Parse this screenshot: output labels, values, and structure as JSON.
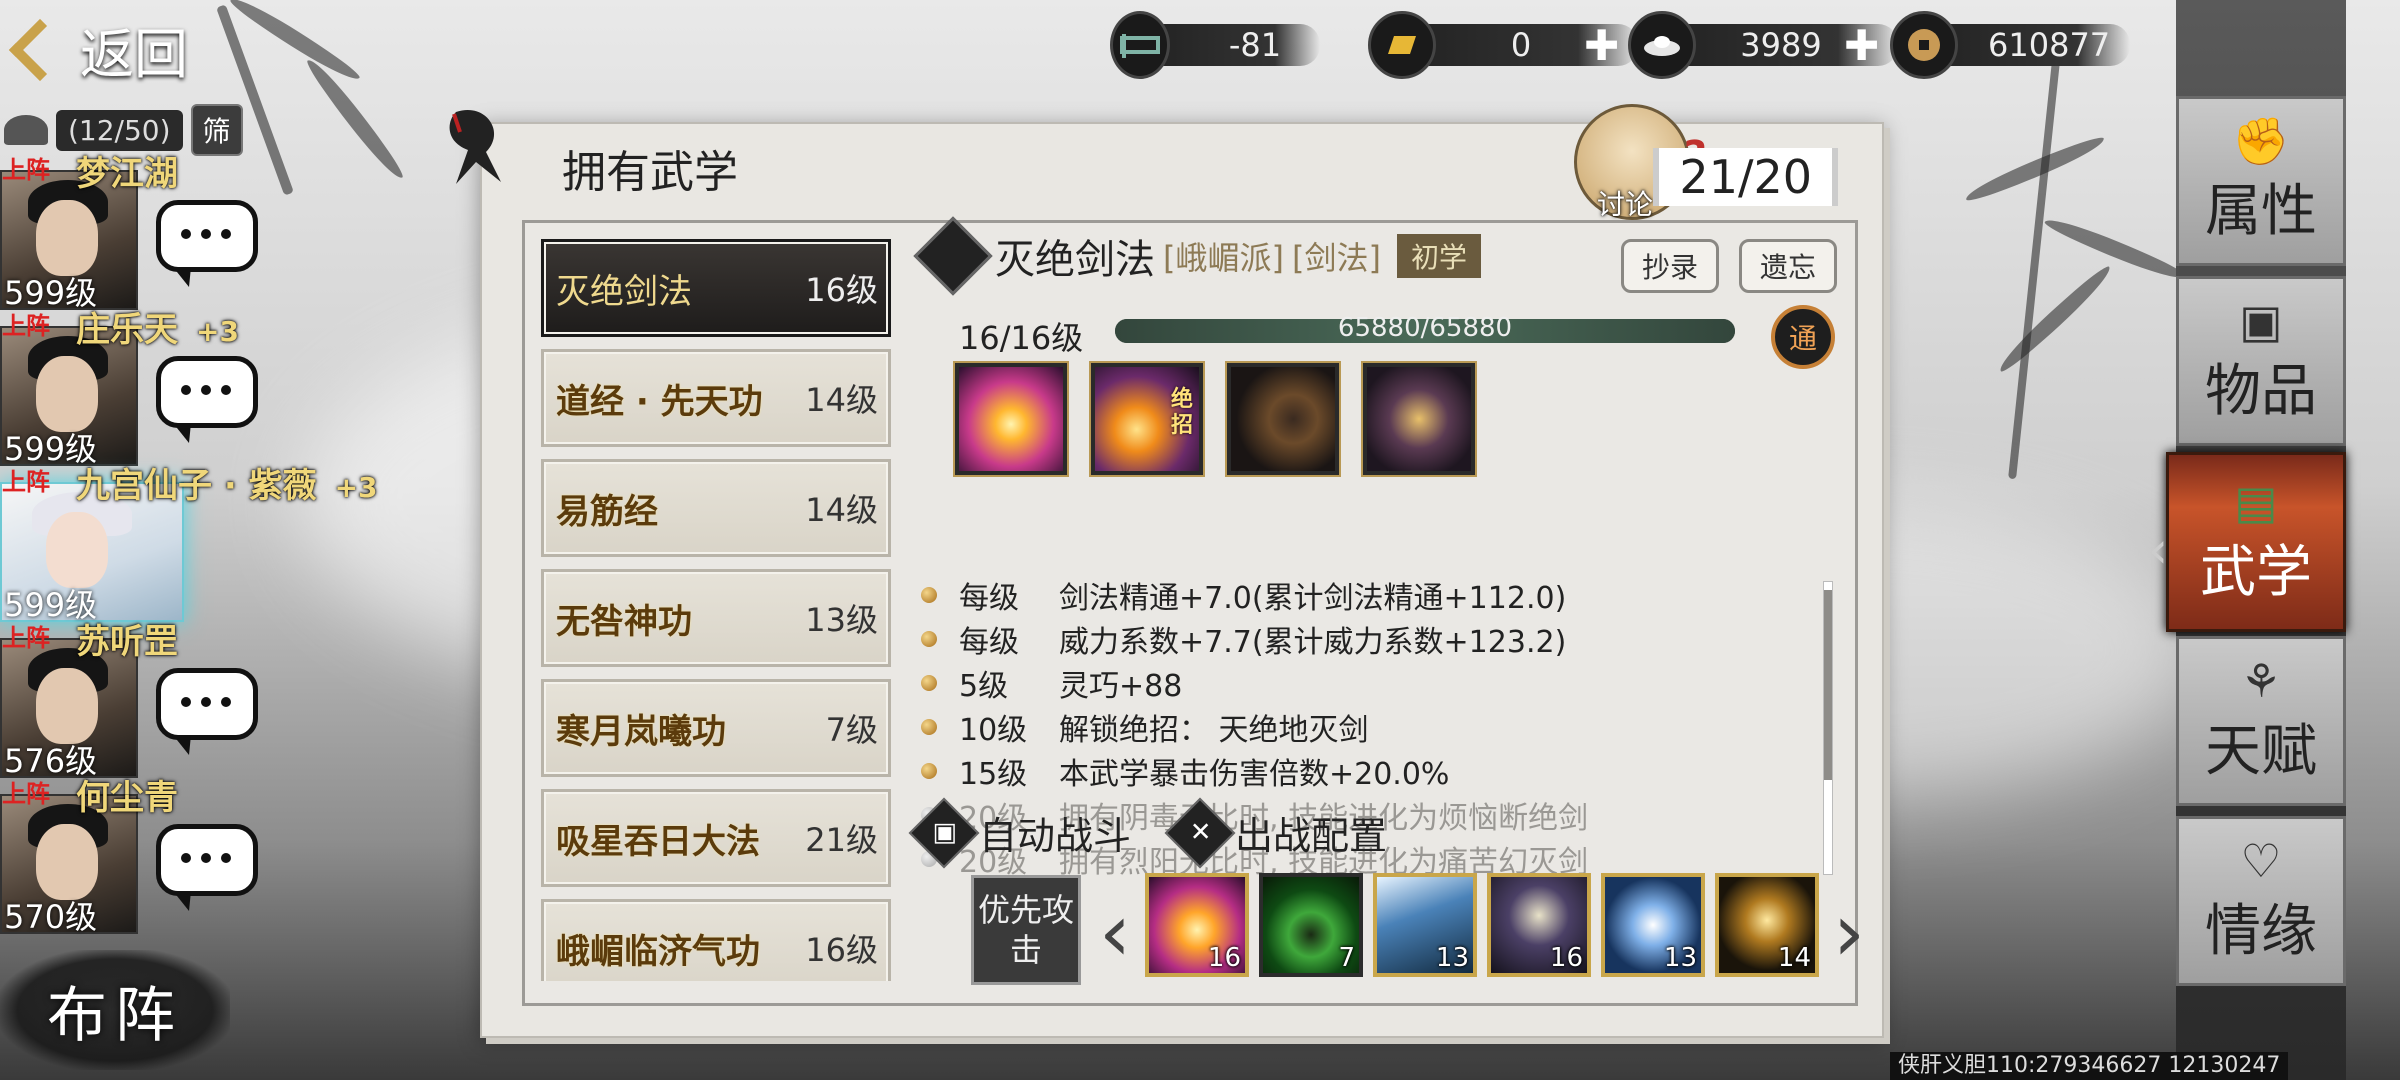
{
  "topbar": {
    "back_label": "返回",
    "resources": [
      {
        "icon": "bed-icon",
        "value": "-81",
        "has_plus": false
      },
      {
        "icon": "gold-ingot-icon",
        "value": "0",
        "has_plus": true
      },
      {
        "icon": "silver-ingot-icon",
        "value": "3989",
        "has_plus": true
      },
      {
        "icon": "copper-coin-icon",
        "value": "610877",
        "has_plus": false
      }
    ],
    "plus_symbol": "✚"
  },
  "roster": {
    "count": "(12/50)",
    "filter_label": "筛",
    "heroes": [
      {
        "tag": "上阵",
        "name": "梦江湖",
        "bonus": "",
        "level": "599级"
      },
      {
        "tag": "上阵",
        "name": "庄乐天",
        "bonus": "+3",
        "level": "599级"
      },
      {
        "tag": "上阵",
        "name": "九宫仙子 · 紫薇",
        "bonus": "+3",
        "level": "599级"
      },
      {
        "tag": "上阵",
        "name": "苏听罡",
        "bonus": "",
        "level": "576级"
      },
      {
        "tag": "上阵",
        "name": "何尘青",
        "bonus": "",
        "level": "570级"
      }
    ],
    "formation_label": "布阵"
  },
  "panel": {
    "title": "拥有武学",
    "discuss_label": "讨论",
    "count": "21/20",
    "skills": [
      {
        "name": "灭绝剑法",
        "level": "16级",
        "selected": true
      },
      {
        "name": "道经 · 先天功",
        "level": "14级"
      },
      {
        "name": "易筋经",
        "level": "14级"
      },
      {
        "name": "无咎神功",
        "level": "13级"
      },
      {
        "name": "寒月岚曦功",
        "level": "7级"
      },
      {
        "name": "吸星吞日大法",
        "level": "21级"
      },
      {
        "name": "峨嵋临济气功",
        "level": "16级"
      }
    ],
    "detail": {
      "name": "灭绝剑法",
      "sect": "[峨嵋派]",
      "category": "[剑法]",
      "rank": "初学",
      "copy_label": "抄录",
      "forget_label": "遗忘",
      "level_label": "16/16级",
      "exp_text": "65880/65880",
      "exp_fraction": 1.0,
      "tong_label": "通",
      "ultimate_label": "绝招",
      "effects": [
        {
          "level": "每级",
          "text": "剑法精通+7.0(累计剑法精通+112.0)",
          "active": true
        },
        {
          "level": "每级",
          "text": "威力系数+7.7(累计威力系数+123.2)",
          "active": true
        },
        {
          "level": "5级",
          "text": "灵巧+88",
          "active": true
        },
        {
          "level": "10级",
          "text": "解锁绝招：  天绝地灭剑",
          "active": true
        },
        {
          "level": "15级",
          "text": "本武学暴击伤害倍数+20.0%",
          "active": true
        },
        {
          "level": "20级",
          "text": "拥有阴毒无比时, 技能进化为烦恼断绝剑",
          "active": false
        },
        {
          "level": "20级",
          "text": "拥有烈阳无比时, 技能进化为痛苦幻灭剑",
          "active": false
        }
      ],
      "auto_battle_label": "自动战斗",
      "battle_config_label": "出战配置",
      "priority_label": "优先攻击",
      "loadout": [
        "16",
        "7",
        "13",
        "16",
        "13",
        "14"
      ]
    }
  },
  "side_menu": [
    {
      "label": "属性",
      "icon": "fist-icon"
    },
    {
      "label": "物品",
      "icon": "gift-box-icon"
    },
    {
      "label": "武学",
      "icon": "book-stack-icon",
      "active": true
    },
    {
      "label": "天赋",
      "icon": "branch-icon"
    },
    {
      "label": "情缘",
      "icon": "heart-knot-icon"
    }
  ],
  "footer": "侠肝义胆110:279346627 12130247"
}
